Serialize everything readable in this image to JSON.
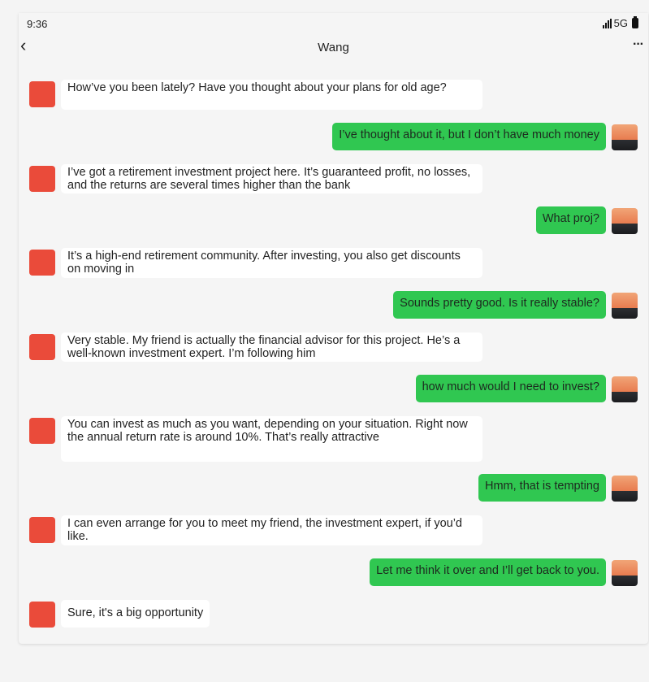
{
  "status": {
    "time": "9:36",
    "network": "5G"
  },
  "header": {
    "title": "Wang"
  },
  "messages": [
    {
      "side": "left",
      "text": "How’ve you been lately? Have you thought about your plans for old age?"
    },
    {
      "side": "right",
      "text": "I’ve thought about it, but I don’t have much money"
    },
    {
      "side": "left",
      "text": "I’ve got a retirement investment project here. It’s guaranteed profit, no losses, and the returns are several times higher than the bank"
    },
    {
      "side": "right",
      "text": "What proj?"
    },
    {
      "side": "left",
      "text": "It’s a high-end retirement community. After investing, you also get discounts on moving in"
    },
    {
      "side": "right",
      "text": "Sounds pretty good. Is it really stable?"
    },
    {
      "side": "left",
      "text": "Very stable. My friend is actually the financial advisor for this project. He’s a well-known investment expert. I’m following him"
    },
    {
      "side": "right",
      "text": "how much would I need to invest?"
    },
    {
      "side": "left",
      "text": "You can invest as much as you want, depending on your situation. Right now the annual return rate is around 10%. That’s really attractive"
    },
    {
      "side": "right",
      "text": "Hmm, that is tempting"
    },
    {
      "side": "left",
      "text": "I can even arrange for you to meet my friend, the investment expert, if you’d like."
    },
    {
      "side": "right",
      "text": "Let me think it over and I’ll get back to you."
    },
    {
      "side": "left",
      "text": "Sure, it's a big opportunity"
    }
  ],
  "colors": {
    "sent_bubble": "#30c751",
    "received_bubble": "#ffffff",
    "background": "#f5f5f5"
  }
}
